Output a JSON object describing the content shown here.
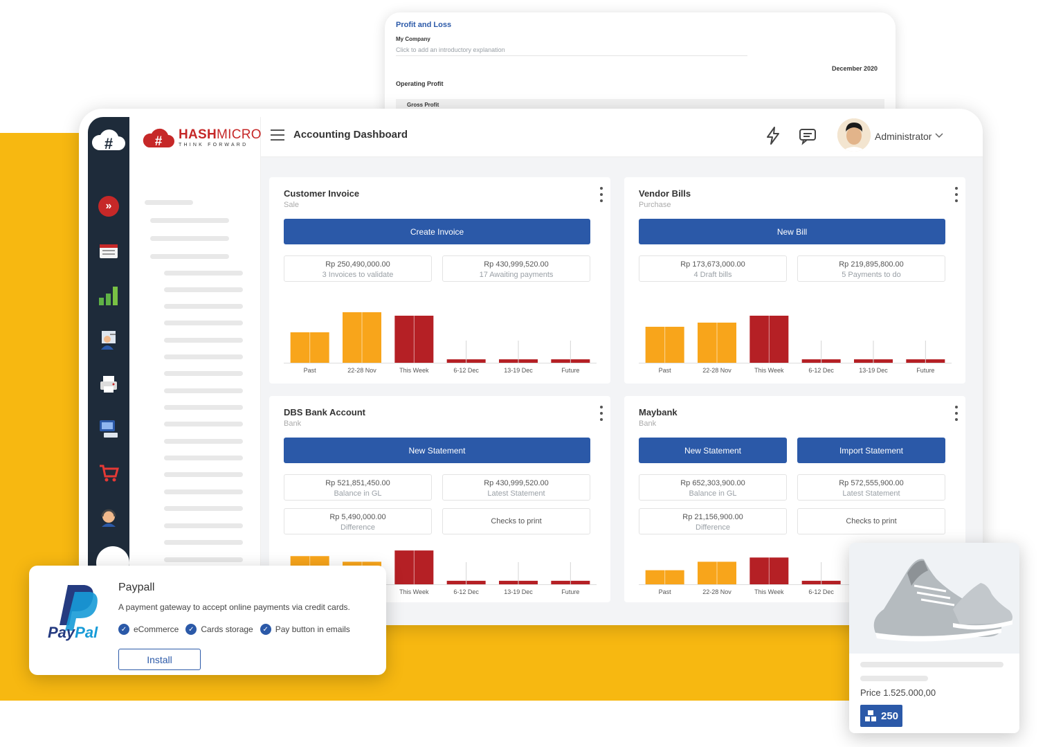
{
  "profit_loss": {
    "title": "Profit and Loss",
    "company": "My Company",
    "explanation": "Click to add an introductory explanation",
    "period": "December 2020",
    "operating_profit": "Operating Profit",
    "gross_profit": "Gross Profit"
  },
  "brand": {
    "name_bold": "HASH",
    "name_rest": "MICRO",
    "tagline": "THINK FORWARD"
  },
  "header": {
    "title": "Accounting Dashboard",
    "user": "Administrator"
  },
  "cards": [
    {
      "title": "Customer Invoice",
      "subtitle": "Sale",
      "buttons": [
        "Create Invoice"
      ],
      "stats": [
        {
          "value": "Rp 250,490,000.00",
          "label": "3 Invoices to validate"
        },
        {
          "value": "Rp 430,999,520.00",
          "label": "17 Awaiting payments"
        }
      ]
    },
    {
      "title": "Vendor Bills",
      "subtitle": "Purchase",
      "buttons": [
        "New Bill"
      ],
      "stats": [
        {
          "value": "Rp 173,673,000.00",
          "label": "4 Draft bills"
        },
        {
          "value": "Rp 219,895,800.00",
          "label": "5 Payments to do"
        }
      ]
    },
    {
      "title": "DBS Bank Account",
      "subtitle": "Bank",
      "buttons": [
        "New Statement"
      ],
      "stats": [
        {
          "value": "Rp 521,851,450.00",
          "label": "Balance in GL"
        },
        {
          "value": "Rp 430,999,520.00",
          "label": "Latest Statement"
        },
        {
          "value": "Rp 5,490,000.00",
          "label": "Difference"
        },
        {
          "value": "Checks to print",
          "label": ""
        }
      ]
    },
    {
      "title": "Maybank",
      "subtitle": "Bank",
      "buttons": [
        "New Statement",
        "Import Statement"
      ],
      "stats": [
        {
          "value": "Rp 652,303,900.00",
          "label": "Balance in GL"
        },
        {
          "value": "Rp 572,555,900.00",
          "label": "Latest Statement"
        },
        {
          "value": "Rp 21,156,900.00",
          "label": "Difference"
        },
        {
          "value": "Checks to print",
          "label": ""
        }
      ]
    }
  ],
  "chart_data": [
    {
      "type": "bar",
      "categories": [
        "Past",
        "22-28 Nov",
        "This Week",
        "6-12 Dec",
        "13-19 Dec",
        "Future"
      ],
      "values": [
        44,
        73,
        68,
        5,
        5,
        5
      ],
      "colors": [
        "#f8a51b",
        "#f8a51b",
        "#b52025",
        "#b52025",
        "#b52025",
        "#b52025"
      ],
      "ylim": [
        0,
        80
      ]
    },
    {
      "type": "bar",
      "categories": [
        "Past",
        "22-28 Nov",
        "This Week",
        "6-12 Dec",
        "13-19 Dec",
        "Future"
      ],
      "values": [
        52,
        58,
        68,
        5,
        5,
        5
      ],
      "colors": [
        "#f8a51b",
        "#f8a51b",
        "#b52025",
        "#b52025",
        "#b52025",
        "#b52025"
      ],
      "ylim": [
        0,
        80
      ]
    },
    {
      "type": "bar",
      "categories": [
        "Past",
        "22-28 Nov",
        "This Week",
        "6-12 Dec",
        "13-19 Dec",
        "Future"
      ],
      "values": [
        40,
        32,
        48,
        5,
        5,
        5
      ],
      "colors": [
        "#f8a51b",
        "#f8a51b",
        "#b52025",
        "#b52025",
        "#b52025",
        "#b52025"
      ],
      "ylim": [
        0,
        55
      ]
    },
    {
      "type": "bar",
      "categories": [
        "Past",
        "22-28 Nov",
        "This Week",
        "6-12 Dec"
      ],
      "values": [
        20,
        32,
        38,
        5
      ],
      "colors": [
        "#f8a51b",
        "#f8a51b",
        "#b52025",
        "#b52025"
      ],
      "ylim": [
        0,
        55
      ]
    }
  ],
  "paypal": {
    "title": "Paypall",
    "description": "A payment gateway to accept online payments via credit cards.",
    "features": [
      "eCommerce",
      "Cards storage",
      "Pay button in emails"
    ],
    "install_label": "Install",
    "logo_text_dark": "Pay",
    "logo_text_light": "Pal"
  },
  "product": {
    "price": "Price 1.525.000,00",
    "stock": "250"
  },
  "colors": {
    "primary": "#2b59a8",
    "accent_yellow": "#f7b811",
    "bar_orange": "#f8a51b",
    "bar_red": "#b52025",
    "brand_red": "#c62828"
  }
}
